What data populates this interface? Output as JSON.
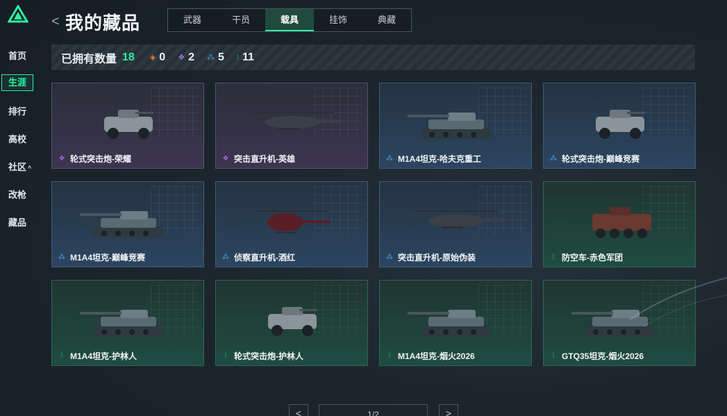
{
  "sidebar": {
    "items": [
      {
        "label": "首页",
        "active": false
      },
      {
        "label": "生涯",
        "active": true
      },
      {
        "label": "排行",
        "active": false
      },
      {
        "label": "高校",
        "active": false
      },
      {
        "label": "社区",
        "active": false,
        "chevron": "^"
      },
      {
        "label": "改枪",
        "active": false
      },
      {
        "label": "藏品",
        "active": false
      }
    ]
  },
  "header": {
    "back_glyph": "<",
    "title": "我的藏品",
    "tabs": [
      {
        "label": "武器",
        "active": false
      },
      {
        "label": "干员",
        "active": false
      },
      {
        "label": "载具",
        "active": true
      },
      {
        "label": "挂饰",
        "active": false
      },
      {
        "label": "典藏",
        "active": false
      }
    ]
  },
  "summary": {
    "owned_label": "已拥有数量",
    "owned_count": "18",
    "rarities": [
      {
        "icon": "orange-diamond-icon",
        "color": "#e0803a",
        "count": "0"
      },
      {
        "icon": "purple-diamond-icon",
        "color": "#a070e0",
        "count": "2"
      },
      {
        "icon": "blue-diamond-icon",
        "color": "#4a9de0",
        "count": "5"
      },
      {
        "icon": "green-diamond-icon",
        "color": "#2cd08a",
        "count": "11"
      }
    ]
  },
  "colors": {
    "accent": "#2cf0a0",
    "purple": "#a070e0",
    "blue": "#4a9de0",
    "green": "#2cd08a"
  },
  "vehicles": [
    {
      "name": "轮式突击炮-荣耀",
      "rarity": "purple",
      "kind": "armored-car"
    },
    {
      "name": "突击直升机-英雄",
      "rarity": "purple",
      "kind": "attack-heli"
    },
    {
      "name": "M1A4坦克-哈夫克重工",
      "rarity": "blue",
      "kind": "tank"
    },
    {
      "name": "轮式突击炮-巅峰竞赛",
      "rarity": "blue",
      "kind": "armored-car"
    },
    {
      "name": "M1A4坦克-巅峰竞赛",
      "rarity": "blue",
      "kind": "tank"
    },
    {
      "name": "侦察直升机-酒红",
      "rarity": "blue",
      "kind": "scout-heli"
    },
    {
      "name": "突击直升机-原始伪装",
      "rarity": "blue",
      "kind": "attack-heli"
    },
    {
      "name": "防空车-赤色军团",
      "rarity": "green",
      "kind": "apc"
    },
    {
      "name": "M1A4坦克-护林人",
      "rarity": "green",
      "kind": "tank"
    },
    {
      "name": "轮式突击炮-护林人",
      "rarity": "green",
      "kind": "armored-car"
    },
    {
      "name": "M1A4坦克-烟火2026",
      "rarity": "green",
      "kind": "tank"
    },
    {
      "name": "GTQ35坦克-烟火2026",
      "rarity": "green",
      "kind": "tank"
    }
  ],
  "pagination": {
    "prev": "<",
    "page": "1/2",
    "next": ">"
  }
}
